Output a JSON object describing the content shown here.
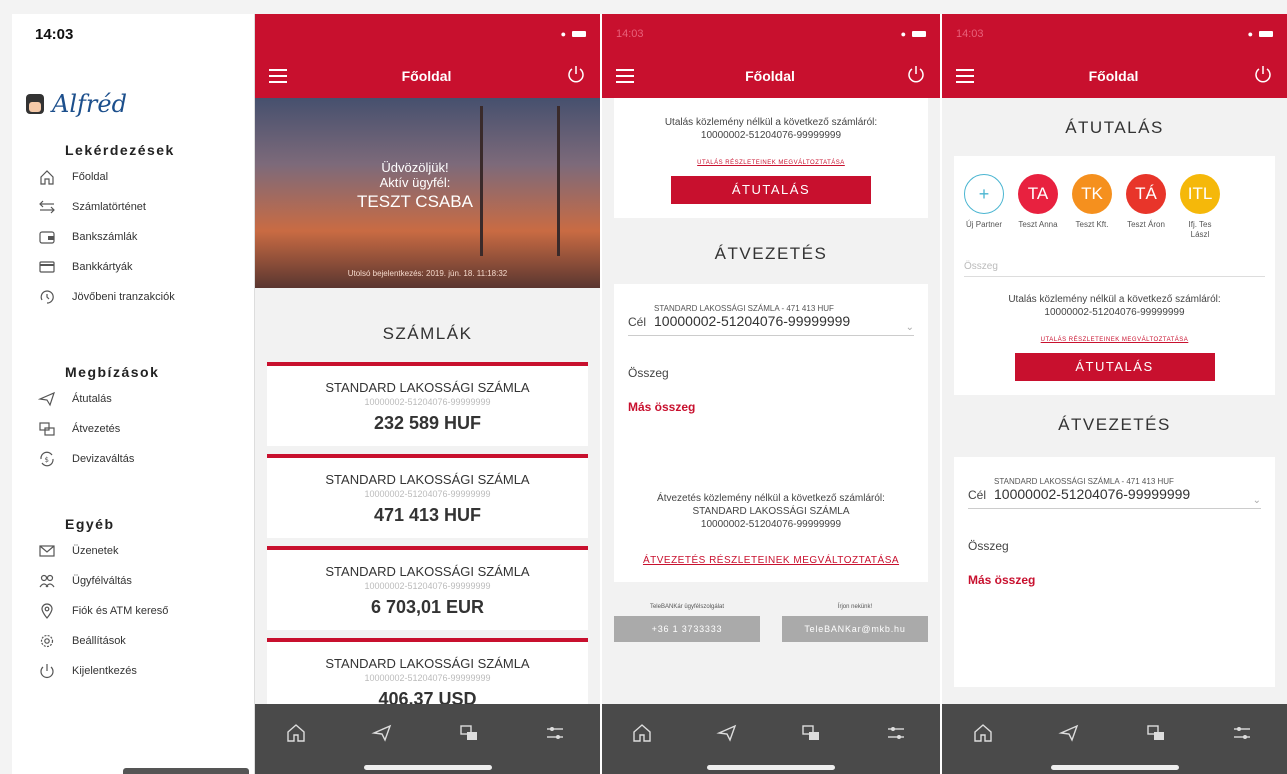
{
  "sidebar": {
    "time": "14:03",
    "logo_name": "Alfréd",
    "sections": [
      {
        "title": "Lekérdezések",
        "items": [
          {
            "icon": "home-icon",
            "label": "Főoldal"
          },
          {
            "icon": "transfer-arrows-icon",
            "label": "Számlatörténet"
          },
          {
            "icon": "wallet-icon",
            "label": "Bankszámlák"
          },
          {
            "icon": "credit-card-icon",
            "label": "Bankkártyák"
          },
          {
            "icon": "future-clock-icon",
            "label": "Jövőbeni tranzakciók"
          }
        ]
      },
      {
        "title": "Megbízások",
        "items": [
          {
            "icon": "send-icon",
            "label": "Átutalás"
          },
          {
            "icon": "move-money-icon",
            "label": "Átvezetés"
          },
          {
            "icon": "currency-exchange-icon",
            "label": "Devizaváltás"
          }
        ]
      },
      {
        "title": "Egyéb",
        "items": [
          {
            "icon": "mail-icon",
            "label": "Üzenetek"
          },
          {
            "icon": "users-icon",
            "label": "Ügyfélváltás"
          },
          {
            "icon": "location-pin-icon",
            "label": "Fiók és ATM kereső"
          },
          {
            "icon": "gear-icon",
            "label": "Beállítások"
          },
          {
            "icon": "power-icon",
            "label": "Kijelentkezés"
          }
        ]
      }
    ]
  },
  "phone1": {
    "title": "Főoldal",
    "hero": {
      "line1": "Üdvözöljük!",
      "line2": "Aktív ügyfél:",
      "line3": "TESZT CSABA",
      "last_login": "Utolsó bejelentkezés: 2019. jún. 18. 11:18:32"
    },
    "section_title": "SZÁMLÁK",
    "accounts": [
      {
        "name": "STANDARD LAKOSSÁGI SZÁMLA",
        "number": "10000002-51204076-99999999",
        "amount": "232 589 HUF"
      },
      {
        "name": "STANDARD LAKOSSÁGI SZÁMLA",
        "number": "10000002-51204076-99999999",
        "amount": "471 413 HUF"
      },
      {
        "name": "STANDARD LAKOSSÁGI SZÁMLA",
        "number": "10000002-51204076-99999999",
        "amount": "6 703,01 EUR"
      },
      {
        "name": "STANDARD LAKOSSÁGI SZÁMLA",
        "number": "10000002-51204076-99999999",
        "amount": "406,37 USD"
      }
    ]
  },
  "phone2": {
    "time": "14:03",
    "title": "Főoldal",
    "transfer_text": "Utalás közlemény nélkül a következő számláról:",
    "transfer_account": "10000002-51204076-99999999",
    "transfer_link": "UTALÁS RÉSZLETEINEK MEGVÁLTOZTATÁSA",
    "transfer_button": "ÁTUTALÁS",
    "section2_title": "ÁTVEZETÉS",
    "cel_label": "Cél",
    "cel_account_name": "STANDARD LAKOSSÁGI SZÁMLA - 471 413 HUF",
    "cel_account_number": "10000002-51204076-99999999",
    "amount_label": "Összeg",
    "other_amount": "Más összeg",
    "move_text": "Átvezetés közlemény nélkül a következő számláról:",
    "move_account_name": "STANDARD LAKOSSÁGI SZÁMLA",
    "move_account_number": "10000002-51204076-99999999",
    "move_link": "ÁTVEZETÉS RÉSZLETEINEK MEGVÁLTOZTATÁSA",
    "helpline_caption": "TeleBANKár ügyfélszolgálat",
    "helpline_number": "+36 1 3733333",
    "write_caption": "Írjon nekünk!",
    "write_email": "TeleBANKar@mkb.hu"
  },
  "phone3": {
    "time": "14:03",
    "title": "Főoldal",
    "section_title": "ÁTUTALÁS",
    "partners": [
      {
        "initials": "+",
        "name": "Új Partner",
        "color": "#ffffff"
      },
      {
        "initials": "TA",
        "name": "Teszt Anna",
        "color": "#e8213f"
      },
      {
        "initials": "TK",
        "name": "Teszt Kft.",
        "color": "#f5901e"
      },
      {
        "initials": "TÁ",
        "name": "Teszt Áron",
        "color": "#e8352a"
      },
      {
        "initials": "ITL",
        "name": "Ifj. Tes Lászl",
        "color": "#f5b80a"
      }
    ],
    "amount_placeholder": "Összeg",
    "transfer_text": "Utalás közlemény nélkül a következő számláról:",
    "transfer_account": "10000002-51204076-99999999",
    "transfer_link": "UTALÁS RÉSZLETEINEK MEGVÁLTOZTATÁSA",
    "transfer_button": "ÁTUTALÁS",
    "section2_title": "ÁTVEZETÉS",
    "cel_label": "Cél",
    "cel_account_name": "STANDARD LAKOSSÁGI SZÁMLA - 471 413 HUF",
    "cel_account_number": "10000002-51204076-99999999",
    "amount_label": "Összeg",
    "other_amount": "Más összeg"
  },
  "colors": {
    "brand_red": "#c8102e",
    "tabbar": "#4a4a4a"
  }
}
